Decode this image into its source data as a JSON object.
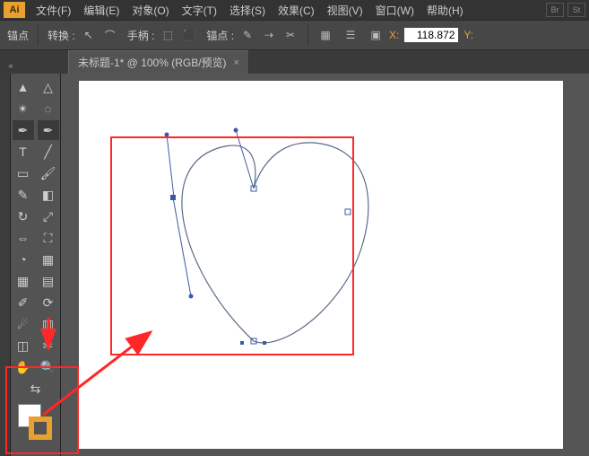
{
  "app": {
    "logo": "Ai"
  },
  "menu": {
    "file": "文件(F)",
    "edit": "编辑(E)",
    "object": "对象(O)",
    "type": "文字(T)",
    "select": "选择(S)",
    "effect": "效果(C)",
    "view": "视图(V)",
    "window": "窗口(W)",
    "help": "帮助(H)"
  },
  "tail": {
    "br": "Br",
    "st": "St"
  },
  "options": {
    "anchor_label": "锚点",
    "convert_label": "转换 :",
    "handle_label": "手柄 :",
    "anchors_label": "锚点 :",
    "x_label": "X:",
    "x_value": "118.872",
    "y_label": "Y:"
  },
  "tab": {
    "title": "未标题-1* @ 100% (RGB/预览)",
    "close_glyph": "×"
  },
  "tools": [
    [
      "selection",
      "direct-selection"
    ],
    [
      "magic-wand",
      "lasso"
    ],
    [
      "pen",
      "pen-convert"
    ],
    [
      "type",
      "line"
    ],
    [
      "rectangle",
      "paintbrush"
    ],
    [
      "pencil",
      "eraser"
    ],
    [
      "rotate",
      "scale"
    ],
    [
      "width",
      "free-transform"
    ],
    [
      "shape-builder",
      "perspective"
    ],
    [
      "mesh",
      "gradient"
    ],
    [
      "eyedropper",
      "blend"
    ],
    [
      "symbol-sprayer",
      "graph"
    ],
    [
      "artboard",
      "slice"
    ],
    [
      "hand",
      "zoom"
    ]
  ],
  "tool_glyphs": {
    "selection": "▲",
    "direct-selection": "△",
    "magic-wand": "✴",
    "lasso": "◌",
    "pen": "✒",
    "pen-convert": "✒",
    "type": "T",
    "line": "╱",
    "rectangle": "▭",
    "paintbrush": "🖌",
    "pencil": "✎",
    "eraser": "◧",
    "rotate": "↻",
    "scale": "⤢",
    "width": "⇔",
    "free-transform": "⛶",
    "shape-builder": "◔",
    "perspective": "▦",
    "mesh": "▦",
    "gradient": "▤",
    "eyedropper": "✐",
    "blend": "⟳",
    "symbol-sprayer": "☄",
    "graph": "▥",
    "artboard": "◫",
    "slice": "✂",
    "hand": "✋",
    "zoom": "🔍"
  },
  "colors": {
    "accent": "#e8a030",
    "annotation": "#ff2727",
    "path_stroke": "#5a6b88",
    "handle": "#3a5aa8"
  }
}
